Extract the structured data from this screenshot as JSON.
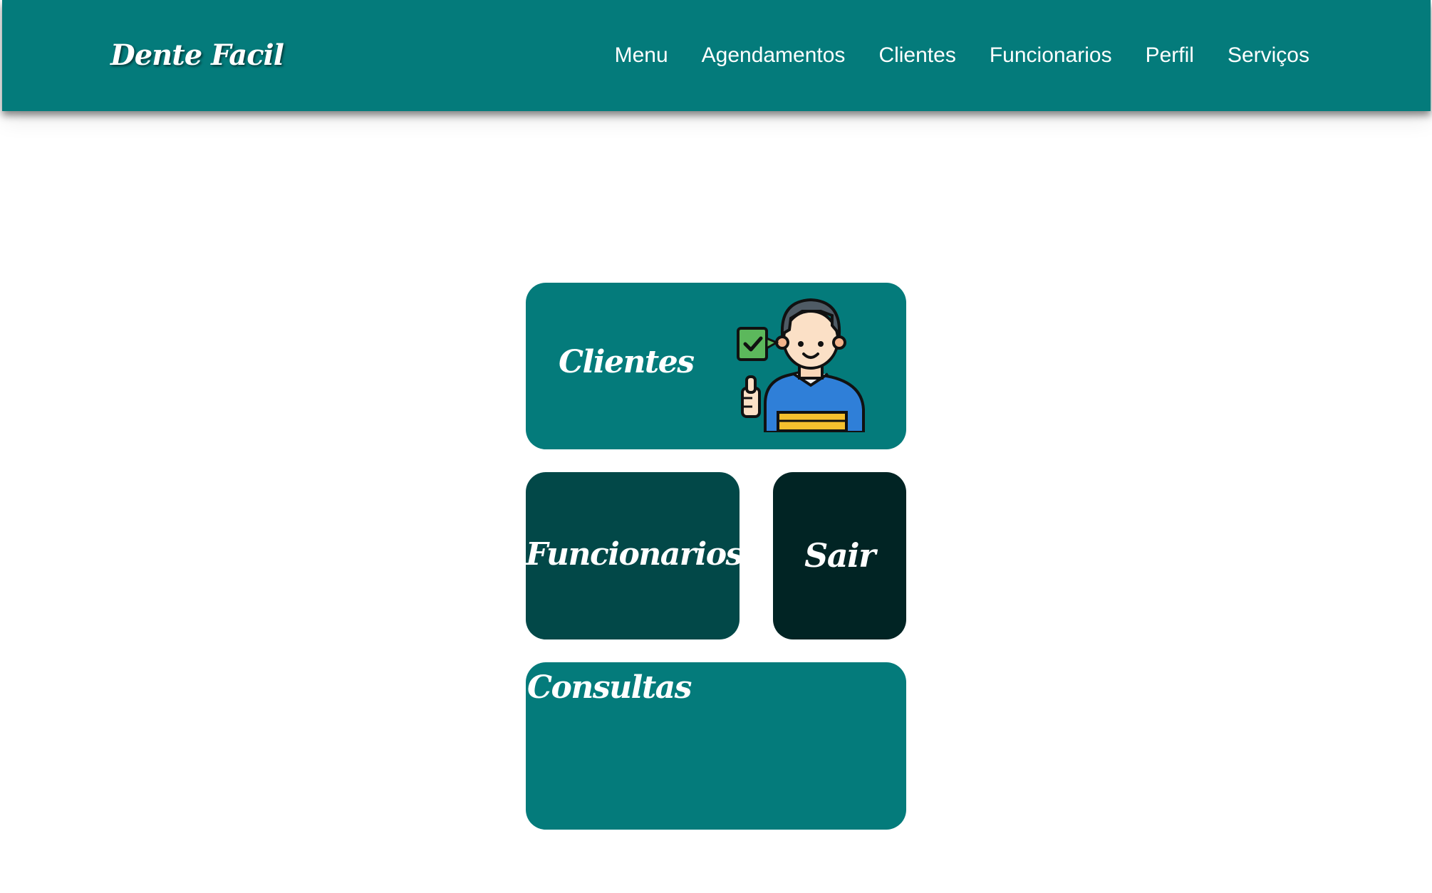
{
  "brand": {
    "name": "Dente Facil"
  },
  "nav": {
    "items": [
      {
        "label": "Menu"
      },
      {
        "label": "Agendamentos"
      },
      {
        "label": "Clientes"
      },
      {
        "label": "Funcionarios"
      },
      {
        "label": "Perfil"
      },
      {
        "label": "Serviços"
      }
    ]
  },
  "cards": {
    "clientes": {
      "label": "Clientes",
      "icon": "customer-thumbs-up-icon"
    },
    "funcionarios": {
      "label": "Funcionarios"
    },
    "sair": {
      "label": "Sair"
    },
    "consultas": {
      "label": "Consultas"
    }
  },
  "colors": {
    "primary": "#047b7b",
    "dark": "#024848",
    "darker": "#012424",
    "text": "#ffffff"
  }
}
